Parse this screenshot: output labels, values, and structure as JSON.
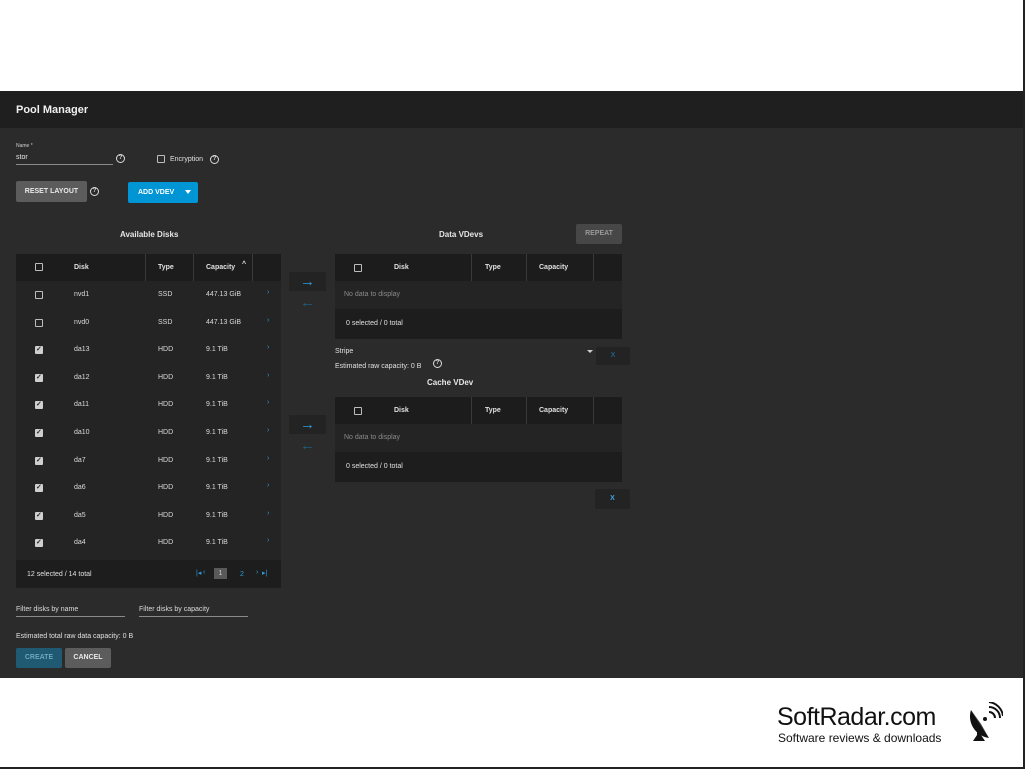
{
  "app": {
    "title": "Pool Manager"
  },
  "name_field": {
    "label": "Name *",
    "value": "stor"
  },
  "encryption": {
    "label": "Encryption",
    "checked": false
  },
  "buttons": {
    "reset_layout": "RESET LAYOUT",
    "add_vdev": "ADD VDEV",
    "repeat": "REPEAT",
    "create": "CREATE",
    "cancel": "CANCEL",
    "remove_x": "X",
    "remove_x2": "X"
  },
  "available_disks": {
    "title": "Available Disks",
    "columns": [
      "Disk",
      "Type",
      "Capacity"
    ],
    "sort_indicator": "^",
    "rows": [
      {
        "disk": "nvd1",
        "type": "SSD",
        "capacity": "447.13 GiB",
        "checked": false
      },
      {
        "disk": "nvd0",
        "type": "SSD",
        "capacity": "447.13 GiB",
        "checked": false
      },
      {
        "disk": "da13",
        "type": "HDD",
        "capacity": "9.1 TiB",
        "checked": true
      },
      {
        "disk": "da12",
        "type": "HDD",
        "capacity": "9.1 TiB",
        "checked": true
      },
      {
        "disk": "da11",
        "type": "HDD",
        "capacity": "9.1 TiB",
        "checked": true
      },
      {
        "disk": "da10",
        "type": "HDD",
        "capacity": "9.1 TiB",
        "checked": true
      },
      {
        "disk": "da7",
        "type": "HDD",
        "capacity": "9.1 TiB",
        "checked": true
      },
      {
        "disk": "da6",
        "type": "HDD",
        "capacity": "9.1 TiB",
        "checked": true
      },
      {
        "disk": "da5",
        "type": "HDD",
        "capacity": "9.1 TiB",
        "checked": true
      },
      {
        "disk": "da4",
        "type": "HDD",
        "capacity": "9.1 TiB",
        "checked": true
      }
    ],
    "footer": "12 selected / 14 total",
    "pager": {
      "first": "|◂",
      "prev": "‹",
      "current": "1",
      "next_page": "2",
      "next": "›",
      "last": "▸|"
    }
  },
  "data_vdevs": {
    "title": "Data VDevs",
    "columns": [
      "Disk",
      "Type",
      "Capacity"
    ],
    "empty": "No data to display",
    "footer": "0 selected / 0 total",
    "layout": "Stripe",
    "estimated": "Estimated raw capacity: 0 B"
  },
  "cache_vdev": {
    "title": "Cache VDev",
    "columns": [
      "Disk",
      "Type",
      "Capacity"
    ],
    "empty": "No data to display",
    "footer": "0 selected / 0 total"
  },
  "filters": {
    "by_name": "Filter disks by name",
    "by_capacity": "Filter disks by capacity"
  },
  "estimated_total": "Estimated total raw data capacity: 0 B",
  "watermark": {
    "brand": "SoftRadar.com",
    "tagline": "Software reviews & downloads"
  },
  "icons": {
    "help": "help-circle-icon",
    "arrow_right": "arrow-right-icon",
    "arrow_left": "arrow-left-icon",
    "dropdown": "caret-down-icon",
    "chevron": "chevron-right-icon",
    "satellite": "satellite-dish-icon"
  },
  "colors": {
    "accent": "#0095d5",
    "background": "#2b2b2b",
    "titlebar": "#1f1f1f"
  }
}
